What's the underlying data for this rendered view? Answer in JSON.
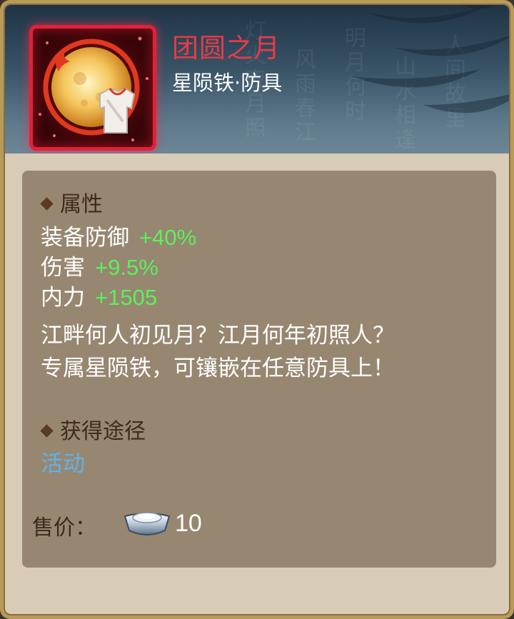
{
  "item": {
    "name": "团圆之月",
    "type": "星陨铁·防具"
  },
  "attributes": {
    "heading": "属性",
    "stats": [
      {
        "label": "装备防御",
        "value": "+40%"
      },
      {
        "label": "伤害",
        "value": "+9.5%"
      },
      {
        "label": "内力",
        "value": "+1505"
      }
    ]
  },
  "description": {
    "line1": "江畔何人初见月？江月何年初照人？",
    "line2": "专属星陨铁，可镶嵌在任意防具上！"
  },
  "acquisition": {
    "heading": "获得途径",
    "source": "活动"
  },
  "price": {
    "label": "售价：",
    "currency_icon": "silver-ingot-icon",
    "value": "10"
  },
  "colors": {
    "title": "#e83b46",
    "stat_value": "#5cf05c",
    "source_link": "#5fb3ec",
    "icon_border": "#e2203a"
  }
}
